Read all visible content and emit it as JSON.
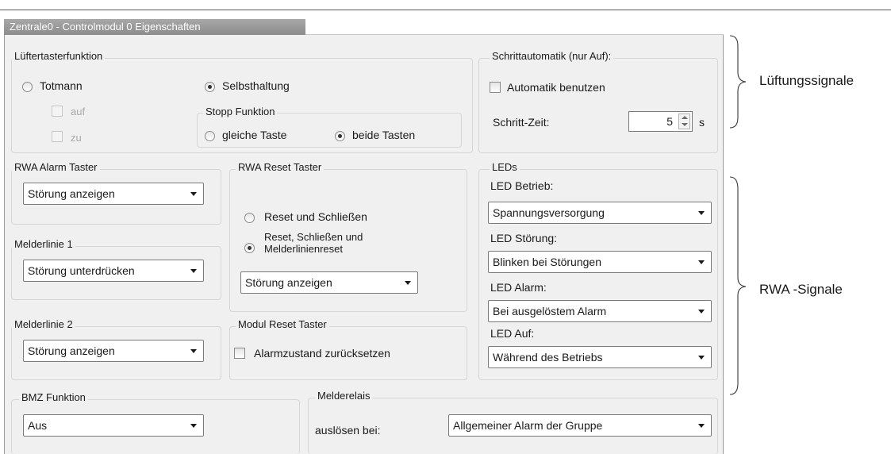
{
  "window": {
    "title": "Zentrale0 - Controlmodul 0 Eigenschaften"
  },
  "lueftertaster": {
    "title": "Lüftertasterfunktion",
    "totmann": "Totmann",
    "auf": "auf",
    "zu": "zu",
    "selbsthaltung": "Selbsthaltung",
    "stopp_title": "Stopp Funktion",
    "gleiche": "gleiche Taste",
    "beide": "beide Tasten"
  },
  "schrittautomatik": {
    "title": "Schrittautomatik (nur Auf):",
    "automatik": "Automatik benutzen",
    "schrittzeit_label": "Schritt-Zeit:",
    "schrittzeit_value": "5",
    "unit": "s"
  },
  "rwa_alarm": {
    "title": "RWA Alarm Taster",
    "value": "Störung anzeigen"
  },
  "melderlinie1": {
    "title": "Melderlinie 1",
    "value": "Störung unterdrücken"
  },
  "melderlinie2": {
    "title": "Melderlinie 2",
    "value": "Störung anzeigen"
  },
  "rwa_reset": {
    "title": "RWA Reset Taster",
    "option1": "Reset und Schließen",
    "option2_line1": "Reset, Schließen und",
    "option2_line2": "Melderlinienreset",
    "value": "Störung anzeigen"
  },
  "modul_reset": {
    "title": "Modul Reset Taster",
    "checkbox": "Alarmzustand zurücksetzen"
  },
  "leds": {
    "title": "LEDs",
    "betrieb_label": "LED Betrieb:",
    "betrieb_value": "Spannungsversorgung",
    "stoerung_label": "LED Störung:",
    "stoerung_value": "Blinken bei Störungen",
    "alarm_label": "LED Alarm:",
    "alarm_value": "Bei ausgelöstem Alarm",
    "auf_label": "LED Auf:",
    "auf_value": "Während des Betriebs"
  },
  "bmz": {
    "title": "BMZ Funktion",
    "value": "Aus"
  },
  "melderelais": {
    "title": "Melderelais",
    "label": "auslösen bei:",
    "value": "Allgemeiner Alarm der Gruppe"
  },
  "annotations": {
    "lueftung": "Lüftungssignale",
    "rwa": "RWA -Signale"
  }
}
